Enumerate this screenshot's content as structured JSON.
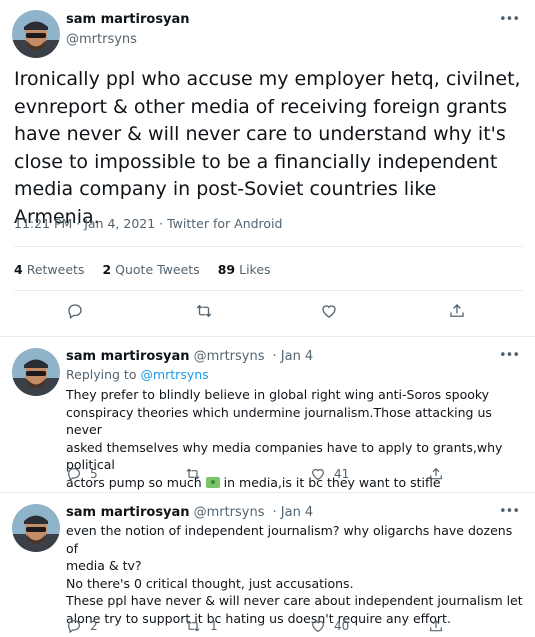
{
  "main_tweet": {
    "author_name": "sam martirosyan",
    "author_handle": "@mrtrsyns",
    "text": "Ironically ppl who accuse my employer hetq, civilnet, evnreport & other media of receiving foreign grants have never & will never care to understand why it's close to impossible to be a financially independent media company in post-Soviet countries like Armenia.",
    "meta": "11:21 PM · Jan 4, 2021 · Twitter for Android",
    "stats": {
      "retweets_count": "4",
      "retweets_label": "Retweets",
      "quotes_count": "2",
      "quotes_label": "Quote Tweets",
      "likes_count": "89",
      "likes_label": "Likes"
    },
    "more_label": "•••"
  },
  "replies": [
    {
      "author_name": "sam martirosyan",
      "author_handle": "@mrtrsyns",
      "date": "· Jan 4",
      "replying_prefix": "Replying to",
      "replying_to": "@mrtrsyns",
      "lines": [
        "They prefer to blindly believe in global right wing anti-Soros spooky",
        "conspiracy theories which undermine journalism.Those attacking us never",
        "asked themselves why media companies have to apply to grants,why political"
      ],
      "line4_before": "actors pump so much",
      "line4_after": "in media,is it bc they want to stifle",
      "reply_count": "5",
      "retweet_count": "",
      "like_count": "41"
    },
    {
      "author_name": "sam martirosyan",
      "author_handle": "@mrtrsyns",
      "date": "· Jan 4",
      "lines": [
        "even the notion of independent journalism? why oligarchs have dozens of",
        "media & tv?",
        "No there's 0 critical thought, just accusations.",
        "These ppl have never & will never care about independent journalism let",
        "alone try to support it bc hating us doesn't require any effort."
      ],
      "reply_count": "2",
      "retweet_count": "1",
      "like_count": "40"
    }
  ],
  "colors": {
    "accent": "#1d9bf0",
    "secondary_text": "#536471",
    "divider": "#e6ecf0"
  },
  "icons": [
    "reply-icon",
    "retweet-icon",
    "like-icon",
    "share-icon",
    "more-icon",
    "money-emoji"
  ]
}
